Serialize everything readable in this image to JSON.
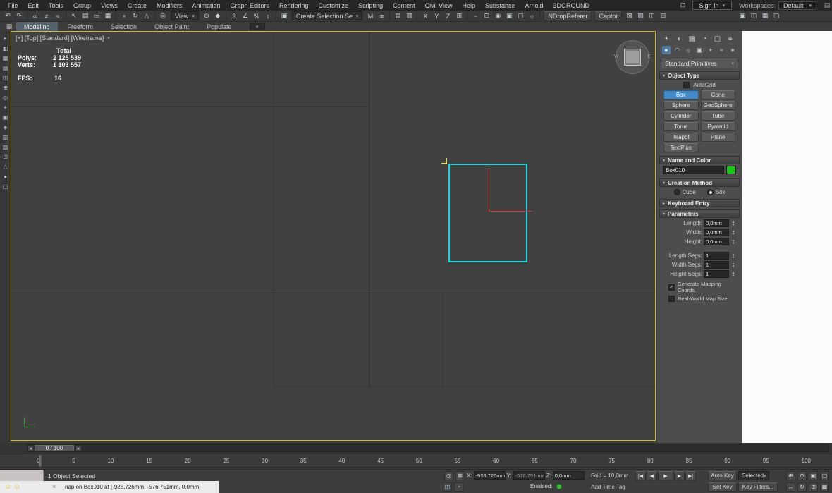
{
  "glyphs": {
    "caret": "▾",
    "collapsed": "▸",
    "expanded": "▾",
    "check": "✓",
    "spin_up": "▴",
    "spin_down": "▾",
    "slider_left": "◂",
    "slider_right": "▸",
    "close": "×",
    "smiley": "☺"
  },
  "menubar": {
    "items": [
      "File",
      "Edit",
      "Tools",
      "Group",
      "Views",
      "Create",
      "Modifiers",
      "Animation",
      "Graph Editors",
      "Rendering",
      "Customize",
      "Scripting",
      "Content",
      "Civil View",
      "Help",
      "Substance",
      "Arnold",
      "3DGROUND"
    ],
    "utility_icon_glyph": "⊡",
    "sign_in": "Sign In",
    "workspaces_label": "Workspaces:",
    "workspace_value": "Default",
    "end_icon_glyph": "▤"
  },
  "toolbar": {
    "group1": [
      {
        "name": "undo-icon",
        "glyph": "↶"
      },
      {
        "name": "redo-icon",
        "glyph": "↷"
      },
      {
        "sep": true
      },
      {
        "name": "select-and-link-icon",
        "glyph": "∞"
      },
      {
        "name": "unlink-selection-icon",
        "glyph": "≠"
      },
      {
        "name": "bind-to-space-warp-icon",
        "glyph": "≈"
      },
      {
        "sep": true
      },
      {
        "name": "select-object-icon",
        "glyph": "↖"
      },
      {
        "name": "select-by-name-icon",
        "glyph": "▤"
      },
      {
        "name": "selection-region-icon",
        "glyph": "▭"
      },
      {
        "name": "window-crossing-icon",
        "glyph": "▦"
      },
      {
        "sep": true
      },
      {
        "name": "select-and-move-icon",
        "glyph": "+"
      },
      {
        "name": "select-and-rotate-icon",
        "glyph": "↻"
      },
      {
        "name": "select-and-scale-icon",
        "glyph": "△"
      },
      {
        "sep": true
      },
      {
        "name": "select-and-place-icon",
        "glyph": "◎"
      }
    ],
    "view_dropdown": "View",
    "group2": [
      {
        "name": "use-center-icon",
        "glyph": "⊙"
      },
      {
        "name": "select-and-manipulate-icon",
        "glyph": "◆"
      },
      {
        "sep": true
      },
      {
        "name": "snaps-toggle-icon",
        "glyph": "3"
      },
      {
        "name": "angle-snap-icon",
        "glyph": "∠"
      },
      {
        "name": "percent-snap-icon",
        "glyph": "%"
      },
      {
        "name": "spinner-snap-icon",
        "glyph": "↕"
      },
      {
        "sep": true
      },
      {
        "name": "edit-named-selections-icon",
        "glyph": "▣"
      }
    ],
    "selection_set_dropdown": "Create Selection Se",
    "group3": [
      {
        "name": "mirror-icon",
        "glyph": "M"
      },
      {
        "name": "align-icon",
        "glyph": "≡"
      },
      {
        "sep": true
      },
      {
        "name": "layer-explorer-icon",
        "glyph": "▤"
      },
      {
        "name": "scene-explorer-icon",
        "glyph": "▥"
      },
      {
        "sep": true
      },
      {
        "name": "x-axis-constraint-button",
        "glyph": "X"
      },
      {
        "name": "y-axis-constraint-button",
        "glyph": "Y"
      },
      {
        "name": "z-axis-constraint-button",
        "glyph": "Z"
      },
      {
        "name": "plane-constraint-icon",
        "glyph": "⊞"
      },
      {
        "sep": true
      },
      {
        "name": "curve-editor-icon",
        "glyph": "~"
      },
      {
        "name": "schematic-view-icon",
        "glyph": "⊡"
      },
      {
        "name": "material-editor-icon",
        "glyph": "◉"
      },
      {
        "name": "render-setup-icon",
        "glyph": "▣"
      },
      {
        "name": "rendered-frame-icon",
        "glyph": "▢"
      },
      {
        "name": "render-production-icon",
        "glyph": "☼"
      },
      {
        "sep": true
      }
    ],
    "ndrop_button": "NDropReferer",
    "captor_button": "Captor",
    "group4": [
      {
        "name": "custom-plugin-icon-1",
        "glyph": "▧"
      },
      {
        "name": "custom-plugin-icon-2",
        "glyph": "▨"
      },
      {
        "name": "custom-plugin-icon-3",
        "glyph": "◫"
      },
      {
        "name": "custom-plugin-icon-4",
        "glyph": "⊞"
      }
    ],
    "group5": [
      {
        "name": "workspace-icon-1",
        "glyph": "▣"
      },
      {
        "name": "workspace-icon-2",
        "glyph": "◫"
      },
      {
        "name": "workspace-icon-3",
        "glyph": "▦"
      },
      {
        "name": "workspace-icon-4",
        "glyph": "▢"
      }
    ]
  },
  "ribbon": {
    "menu_icon_glyph": "▦",
    "tabs": [
      {
        "label": "Modeling",
        "active": true
      },
      {
        "label": "Freeform"
      },
      {
        "label": "Selection"
      },
      {
        "label": "Object Paint"
      },
      {
        "label": "Populate"
      }
    ]
  },
  "left_toolbar": {
    "icons": [
      {
        "name": "side-tool-icon-1",
        "glyph": "▸"
      },
      {
        "name": "side-tool-icon-2",
        "glyph": "◧"
      },
      {
        "name": "side-tool-icon-3",
        "glyph": "▦"
      },
      {
        "name": "side-tool-icon-4",
        "glyph": "▤"
      },
      {
        "name": "side-tool-icon-5",
        "glyph": "◫"
      },
      {
        "name": "side-tool-icon-6",
        "glyph": "⊞"
      },
      {
        "name": "side-tool-icon-7",
        "glyph": "◎"
      },
      {
        "name": "side-tool-icon-8",
        "glyph": "+"
      },
      {
        "name": "side-tool-icon-9",
        "glyph": "▣"
      },
      {
        "name": "side-tool-icon-10",
        "glyph": "◈"
      },
      {
        "name": "side-tool-icon-11",
        "glyph": "▥"
      },
      {
        "name": "side-tool-icon-12",
        "glyph": "▧"
      },
      {
        "name": "side-tool-icon-13",
        "glyph": "⊡"
      },
      {
        "name": "side-tool-icon-14",
        "glyph": "△"
      },
      {
        "name": "side-tool-icon-15",
        "glyph": "●"
      },
      {
        "name": "side-tool-icon-16",
        "glyph": "▢"
      }
    ]
  },
  "viewport": {
    "label": "[+] [Top] [Standard] [Wireframe]",
    "stats": {
      "total": "Total",
      "rows": [
        {
          "label": "Polys:",
          "value": "2 125 539"
        },
        {
          "label": "Verts:",
          "value": "1 103 557"
        }
      ],
      "fps_label": "FPS:",
      "fps_value": "16"
    },
    "viewcube": {
      "west": "W",
      "east": "E"
    }
  },
  "command_panel": {
    "tabs": [
      {
        "name": "create-tab-icon",
        "glyph": "+"
      },
      {
        "name": "modify-tab-icon",
        "glyph": "◐"
      },
      {
        "name": "hierarchy-tab-icon",
        "glyph": "▤"
      },
      {
        "name": "motion-tab-icon",
        "glyph": "◔"
      },
      {
        "name": "display-tab-icon",
        "glyph": "▢"
      },
      {
        "name": "utilities-tab-icon",
        "glyph": "≡"
      }
    ],
    "subtabs": [
      {
        "name": "geometry-icon",
        "glyph": "●",
        "active": true
      },
      {
        "name": "shapes-icon",
        "glyph": "◠"
      },
      {
        "name": "lights-icon",
        "glyph": "☼"
      },
      {
        "name": "cameras-icon",
        "glyph": "▣"
      },
      {
        "name": "helpers-icon",
        "glyph": "+"
      },
      {
        "name": "space-warps-icon",
        "glyph": "≈"
      },
      {
        "name": "systems-icon",
        "glyph": "∗"
      }
    ],
    "category_dropdown": "Standard Primitives",
    "object_type": {
      "title": "Object Type",
      "autogrid": "AutoGrid",
      "buttons": [
        {
          "label": "Box",
          "active": true
        },
        {
          "label": "Cone"
        },
        {
          "label": "Sphere"
        },
        {
          "label": "GeoSphere"
        },
        {
          "label": "Cylinder"
        },
        {
          "label": "Tube"
        },
        {
          "label": "Torus"
        },
        {
          "label": "Pyramid"
        },
        {
          "label": "Teapot"
        },
        {
          "label": "Plane"
        },
        {
          "label": "TextPlus"
        }
      ]
    },
    "name_and_color": {
      "title": "Name and Color",
      "name": "Box010"
    },
    "creation_method": {
      "title": "Creation Method",
      "option_cube": "Cube",
      "option_box": "Box",
      "selected": "Box"
    },
    "keyboard_entry": {
      "title": "Keyboard Entry"
    },
    "parameters": {
      "title": "Parameters",
      "spinners": [
        {
          "label": "Length:",
          "value": "0,0mm"
        },
        {
          "label": "Width:",
          "value": "0,0mm"
        },
        {
          "label": "Height:",
          "value": "0,0mm"
        },
        {
          "label": "Length Segs:",
          "value": "1"
        },
        {
          "label": "Width Segs:",
          "value": "1"
        },
        {
          "label": "Height Segs:",
          "value": "1"
        }
      ],
      "generate_mapping": "Generate Mapping Coords.",
      "real_world": "Real-World Map Size"
    }
  },
  "timeline": {
    "handle": "0 / 100",
    "ticks": [
      "0",
      "5",
      "10",
      "15",
      "20",
      "25",
      "30",
      "35",
      "40",
      "45",
      "50",
      "55",
      "60",
      "65",
      "70",
      "75",
      "80",
      "85",
      "90",
      "95",
      "100"
    ]
  },
  "status": {
    "selected_text": "1 Object Selected",
    "listener_text": "nap on Box010 at [-928,726mm, -576,751mm, 0,0mm]",
    "row1_icons": [
      {
        "name": "isolate-selection-icon",
        "glyph": "◎"
      },
      {
        "name": "selection-lock-icon",
        "glyph": "⊠"
      }
    ],
    "coords": {
      "x_label": "X:",
      "x_value": "-928,726mm",
      "y_label": "Y:",
      "y_value": "-576,751mm",
      "z_label": "Z:",
      "z_value": "0,0mm"
    },
    "grid_text": "Grid = 10,0mm",
    "playback": [
      {
        "name": "go-to-start-icon",
        "glyph": "|◀"
      },
      {
        "name": "previous-frame-icon",
        "glyph": "◀"
      },
      {
        "name": "play-icon",
        "glyph": "▶",
        "wide": true
      },
      {
        "name": "next-frame-icon",
        "glyph": "▶"
      },
      {
        "name": "go-to-end-icon",
        "glyph": "▶|"
      }
    ],
    "auto_key": "Auto Key",
    "selected_dropdown": "Selected",
    "nav_icons_row1": [
      {
        "name": "zoom-icon",
        "glyph": "⊕"
      },
      {
        "name": "zoom-all-icon",
        "glyph": "⊙"
      },
      {
        "name": "zoom-extents-icon",
        "glyph": "▣"
      },
      {
        "name": "field-of-view-icon",
        "glyph": "▢"
      }
    ],
    "row2_icons": [
      {
        "name": "mini-listener-icon",
        "glyph": "◫"
      },
      {
        "name": "time-configuration-icon",
        "glyph": "◔"
      }
    ],
    "enabled_label": "Enabled:",
    "add_time_tag": "Add Time Tag",
    "set_key": "Set Key",
    "key_filters": "Key Filters...",
    "nav_icons_row2": [
      {
        "name": "pan-icon",
        "glyph": "↔"
      },
      {
        "name": "orbit-icon",
        "glyph": "↻"
      },
      {
        "name": "maximize-viewport-icon",
        "glyph": "⊞"
      },
      {
        "name": "viewport-layout-icon",
        "glyph": "▦"
      }
    ]
  },
  "colors": {
    "active_button": "#4189c7",
    "viewport_border": "#d7b926",
    "object_swatch": "#17c617",
    "box_outline": "#1fd8de"
  }
}
